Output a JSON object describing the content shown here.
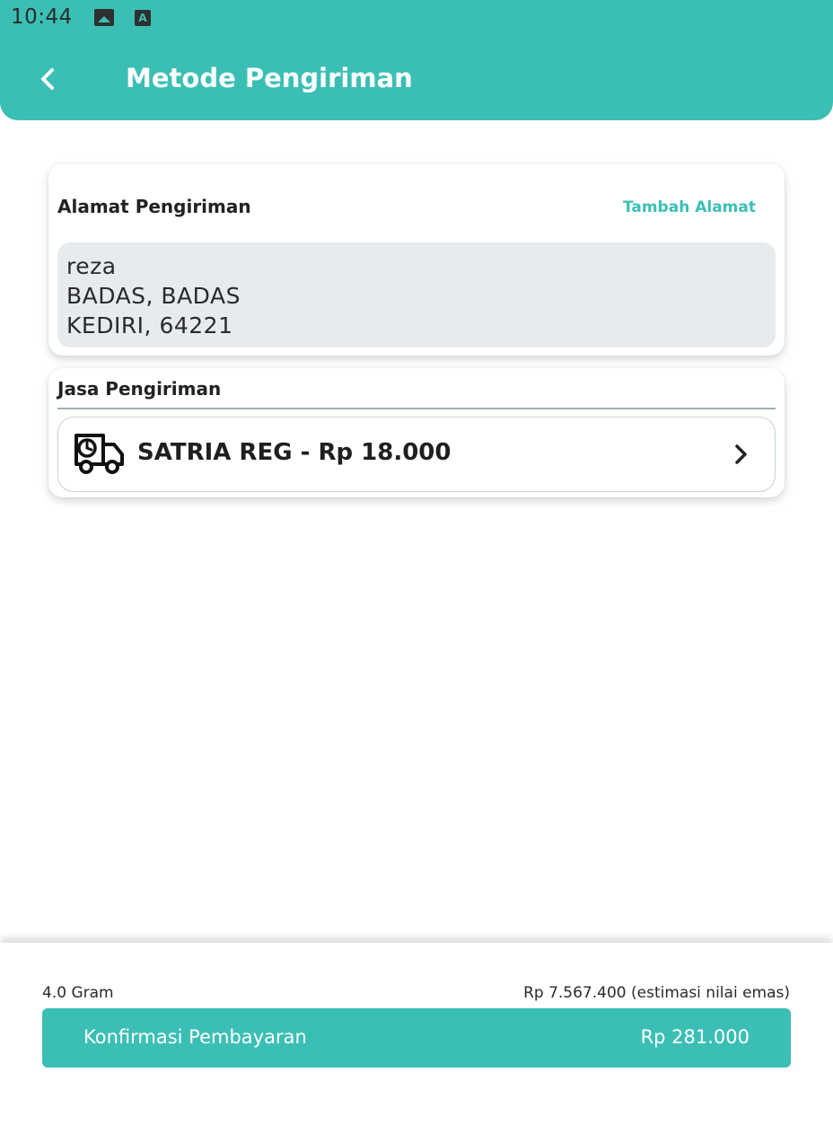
{
  "status_bar": {
    "time": "10:44",
    "icons": [
      "image-icon",
      "a-box-icon"
    ]
  },
  "header": {
    "title": "Metode Pengiriman",
    "back_icon": "chevron-left-icon"
  },
  "address_card": {
    "title": "Alamat Pengiriman",
    "add_link": "Tambah Alamat",
    "lines": [
      "reza",
      "BADAS, BADAS",
      "KEDIRI, 64221"
    ]
  },
  "shipping_card": {
    "title": "Jasa Pengiriman",
    "courier": "SATRIA REG - Rp 18.000",
    "icon": "delivery-truck-icon"
  },
  "footer": {
    "weight": "4.0 Gram",
    "estimate": "Rp 7.567.400 (estimasi nilai emas)",
    "confirm_label": "Konfirmasi Pembayaran",
    "confirm_amount": "Rp 281.000"
  },
  "colors": {
    "accent": "#3bbfb5",
    "address_bg": "#e8ebee"
  }
}
